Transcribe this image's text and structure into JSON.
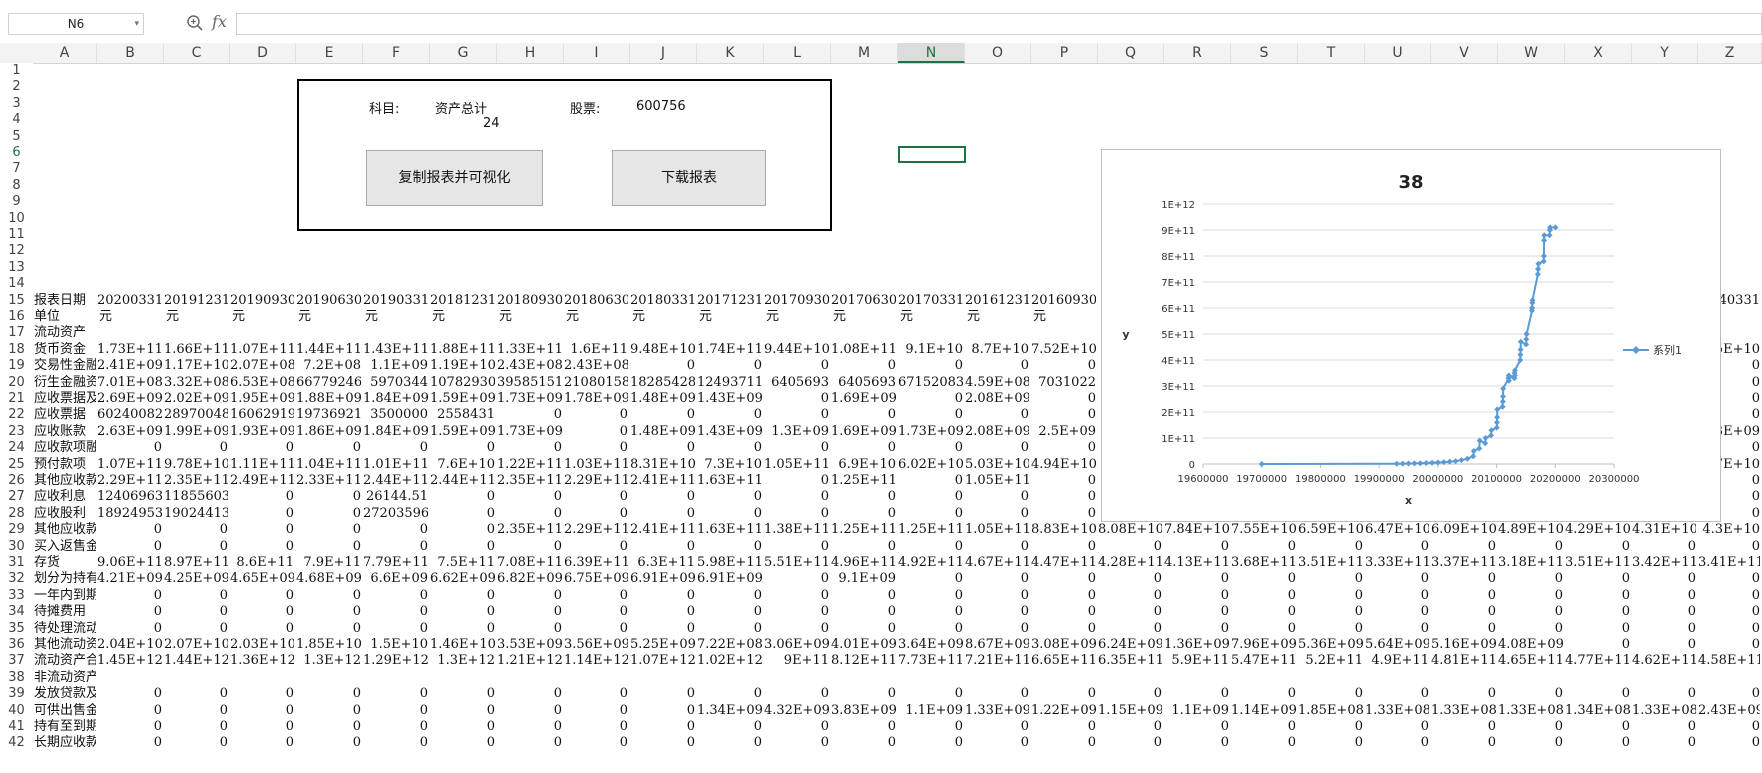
{
  "name_box": "N6",
  "formula_value": "",
  "columns": [
    "A",
    "B",
    "C",
    "D",
    "E",
    "F",
    "G",
    "H",
    "I",
    "J",
    "K",
    "L",
    "M",
    "N",
    "O",
    "P",
    "Q",
    "R",
    "S",
    "T",
    "U",
    "V",
    "W",
    "X",
    "Y",
    "Z"
  ],
  "selected_column": "N",
  "rows": [
    "1",
    "2",
    "3",
    "4",
    "5",
    "6",
    "7",
    "8",
    "9",
    "10",
    "11",
    "12",
    "13",
    "14",
    "15",
    "16",
    "17",
    "18",
    "19",
    "20",
    "21",
    "22",
    "23",
    "24",
    "25",
    "26",
    "27",
    "28",
    "29",
    "30",
    "31",
    "32",
    "33",
    "34",
    "35",
    "36",
    "37",
    "38",
    "39",
    "40",
    "41",
    "42"
  ],
  "selected_row": "6",
  "panel": {
    "subject_label": "科目:",
    "subject_value": "资产总计",
    "subject_index": "24",
    "stock_label": "股票:",
    "stock_code": "600756",
    "copy_button": "复制报表并可视化",
    "download_button": "下载报表"
  },
  "sheet": {
    "header_row": [
      "报表日期",
      "20200331",
      "20191231",
      "20190930",
      "20190630",
      "20190331",
      "20181231",
      "20180930",
      "20180630",
      "20180331",
      "20171231",
      "20170930",
      "20170630",
      "20170331",
      "20161231",
      "20160930",
      "",
      "",
      "",
      "",
      "",
      "",
      "",
      "",
      "",
      "140331"
    ],
    "unit_row": [
      "单位",
      "元",
      "元",
      "元",
      "元",
      "元",
      "元",
      "元",
      "元",
      "元",
      "元",
      "元",
      "元",
      "元",
      "元",
      "元"
    ],
    "data_rows": [
      [
        "流动资产"
      ],
      [
        "货币资金",
        "1.73E+11",
        "1.66E+11",
        "1.07E+11",
        "1.44E+11",
        "1.43E+11",
        "1.88E+11",
        "1.33E+11",
        "1.6E+11",
        "9.48E+10",
        "1.74E+11",
        "9.44E+10",
        "1.08E+11",
        "9.1E+10",
        "8.7E+10",
        "7.52E+10",
        "",
        "",
        "",
        "",
        "",
        "",
        "",
        "",
        "",
        "75E+10"
      ],
      [
        "交易性金融",
        "2.41E+09",
        "1.17E+10",
        "2.07E+08",
        "7.2E+08",
        "1.1E+09",
        "1.19E+10",
        "2.43E+08",
        "2.43E+08",
        "0",
        "0",
        "0",
        "0",
        "0",
        "0",
        "0",
        "",
        "",
        "",
        "",
        "",
        "",
        "",
        "",
        "",
        "0"
      ],
      [
        "衍生金融资",
        "7.01E+08",
        "3.32E+08",
        "6.53E+08",
        "66779246",
        "5970344",
        "10782930",
        "39585151",
        "21080158",
        "18285428",
        "12493711",
        "6405693",
        "6405693",
        "67152083",
        "4.59E+08",
        "7031022",
        "",
        "",
        "",
        "",
        "",
        "",
        "",
        "",
        "",
        "0"
      ],
      [
        "应收票据及",
        "2.69E+09",
        "2.02E+09",
        "1.95E+09",
        "1.88E+09",
        "1.84E+09",
        "1.59E+09",
        "1.73E+09",
        "1.78E+09",
        "1.48E+09",
        "1.43E+09",
        "0",
        "1.69E+09",
        "0",
        "2.08E+09",
        "0",
        "",
        "",
        "",
        "",
        "",
        "",
        "",
        "",
        "",
        "0"
      ],
      [
        "应收票据",
        "60240082",
        "28970048",
        "16062919",
        "19736921",
        "3500000",
        "2558431",
        "0",
        "0",
        "0",
        "0",
        "0",
        "0",
        "0",
        "0",
        "0",
        "",
        "",
        "",
        "",
        "",
        "",
        "",
        "",
        "",
        "0"
      ],
      [
        "应收账款",
        "2.63E+09",
        "1.99E+09",
        "1.93E+09",
        "1.86E+09",
        "1.84E+09",
        "1.59E+09",
        "1.73E+09",
        "0",
        "1.48E+09",
        "1.43E+09",
        "1.3E+09",
        "1.69E+09",
        "1.73E+09",
        "2.08E+09",
        "2.5E+09",
        "",
        "",
        "",
        "",
        "",
        "",
        "",
        "",
        "",
        "93E+09"
      ],
      [
        "应收款项融",
        "0",
        "0",
        "0",
        "0",
        "0",
        "0",
        "0",
        "0",
        "0",
        "0",
        "0",
        "0",
        "0",
        "0",
        "0",
        "",
        "",
        "",
        "",
        "",
        "",
        "",
        "",
        "",
        "0"
      ],
      [
        "预付款项",
        "1.07E+11",
        "9.78E+10",
        "1.11E+11",
        "1.04E+11",
        "1.01E+11",
        "7.6E+10",
        "1.22E+11",
        "1.03E+11",
        "8.31E+10",
        "7.3E+10",
        "1.05E+11",
        "6.9E+10",
        "6.02E+10",
        "5.03E+10",
        "4.94E+10",
        "",
        "",
        "",
        "",
        "",
        "",
        "",
        "",
        "",
        "37E+10"
      ],
      [
        "其他应收款",
        "2.29E+11",
        "2.35E+11",
        "2.49E+11",
        "2.33E+11",
        "2.44E+11",
        "2.44E+11",
        "2.35E+11",
        "2.29E+11",
        "2.41E+11",
        "1.63E+11",
        "0",
        "1.25E+11",
        "0",
        "1.05E+11",
        "0",
        "",
        "",
        "",
        "",
        "",
        "",
        "",
        "",
        "",
        "0"
      ],
      [
        "应收利息",
        "12406963",
        "11855603",
        "0",
        "0",
        "26144.51",
        "0",
        "0",
        "0",
        "0",
        "0",
        "0",
        "0",
        "0",
        "0",
        "0",
        "",
        "",
        "",
        "",
        "",
        "",
        "",
        "",
        "",
        "0"
      ],
      [
        "应收股利",
        "18924953",
        "19024413",
        "0",
        "0",
        "27203596",
        "0",
        "0",
        "0",
        "0",
        "0",
        "0",
        "0",
        "0",
        "0",
        "0",
        "",
        "",
        "",
        "",
        "",
        "",
        "",
        "",
        "",
        "0"
      ],
      [
        "其他应收款",
        "0",
        "0",
        "0",
        "0",
        "0",
        "0",
        "2.35E+11",
        "2.29E+11",
        "2.41E+11",
        "1.63E+11",
        "1.38E+11",
        "1.25E+11",
        "1.25E+11",
        "1.05E+11",
        "8.83E+10",
        "8.08E+10",
        "7.84E+10",
        "7.55E+10",
        "6.59E+10",
        "6.47E+10",
        "6.09E+10",
        "4.89E+10",
        "4.29E+10",
        "4.31E+10",
        "4.3E+10"
      ],
      [
        "买入返售金",
        "0",
        "0",
        "0",
        "0",
        "0",
        "0",
        "0",
        "0",
        "0",
        "0",
        "0",
        "0",
        "0",
        "0",
        "0",
        "0",
        "0",
        "0",
        "0",
        "0",
        "0",
        "0",
        "0",
        "0",
        "0"
      ],
      [
        "存货",
        "9.06E+11",
        "8.97E+11",
        "8.6E+11",
        "7.9E+11",
        "7.79E+11",
        "7.5E+11",
        "7.08E+11",
        "6.39E+11",
        "6.3E+11",
        "5.98E+11",
        "5.51E+11",
        "4.96E+11",
        "4.92E+11",
        "4.67E+11",
        "4.47E+11",
        "4.28E+11",
        "4.13E+11",
        "3.68E+11",
        "3.51E+11",
        "3.33E+11",
        "3.37E+11",
        "3.18E+11",
        "3.51E+11",
        "3.42E+11",
        "3.41E+11"
      ],
      [
        "划分为持有",
        "4.21E+09",
        "4.25E+09",
        "4.65E+09",
        "4.68E+09",
        "6.6E+09",
        "6.62E+09",
        "6.82E+09",
        "6.75E+09",
        "6.91E+09",
        "6.91E+09",
        "0",
        "9.1E+09",
        "0",
        "0",
        "0",
        "0",
        "0",
        "0",
        "0",
        "0",
        "0",
        "0",
        "0",
        "0",
        "0"
      ],
      [
        "一年内到期",
        "0",
        "0",
        "0",
        "0",
        "0",
        "0",
        "0",
        "0",
        "0",
        "0",
        "0",
        "0",
        "0",
        "0",
        "0",
        "0",
        "0",
        "0",
        "0",
        "0",
        "0",
        "0",
        "0",
        "0",
        "0"
      ],
      [
        "待摊费用",
        "0",
        "0",
        "0",
        "0",
        "0",
        "0",
        "0",
        "0",
        "0",
        "0",
        "0",
        "0",
        "0",
        "0",
        "0",
        "0",
        "0",
        "0",
        "0",
        "0",
        "0",
        "0",
        "0",
        "0",
        "0"
      ],
      [
        "待处理流动",
        "0",
        "0",
        "0",
        "0",
        "0",
        "0",
        "0",
        "0",
        "0",
        "0",
        "0",
        "0",
        "0",
        "0",
        "0",
        "0",
        "0",
        "0",
        "0",
        "0",
        "0",
        "0",
        "0",
        "0",
        "0"
      ],
      [
        "其他流动资",
        "2.04E+10",
        "2.07E+10",
        "2.03E+10",
        "1.85E+10",
        "1.5E+10",
        "1.46E+10",
        "3.53E+09",
        "3.56E+09",
        "5.25E+09",
        "7.22E+08",
        "3.06E+09",
        "4.01E+09",
        "3.64E+09",
        "8.67E+09",
        "3.08E+09",
        "6.24E+09",
        "1.36E+09",
        "7.96E+09",
        "5.36E+09",
        "5.64E+09",
        "5.16E+09",
        "4.08E+09",
        "0",
        "0",
        "0"
      ],
      [
        "流动资产合",
        "1.45E+12",
        "1.44E+12",
        "1.36E+12",
        "1.3E+12",
        "1.29E+12",
        "1.3E+12",
        "1.21E+12",
        "1.14E+12",
        "1.07E+12",
        "1.02E+12",
        "9E+11",
        "8.12E+11",
        "7.73E+11",
        "7.21E+11",
        "6.65E+11",
        "6.35E+11",
        "5.9E+11",
        "5.47E+11",
        "5.2E+11",
        "4.9E+11",
        "4.81E+11",
        "4.65E+11",
        "4.77E+11",
        "4.62E+11",
        "4.58E+11"
      ],
      [
        "非流动资产"
      ],
      [
        "发放贷款及",
        "0",
        "0",
        "0",
        "0",
        "0",
        "0",
        "0",
        "0",
        "0",
        "0",
        "0",
        "0",
        "0",
        "0",
        "0",
        "0",
        "0",
        "0",
        "0",
        "0",
        "0",
        "0",
        "0",
        "0",
        "0"
      ],
      [
        "可供出售金",
        "0",
        "0",
        "0",
        "0",
        "0",
        "0",
        "0",
        "0",
        "0",
        "1.34E+09",
        "4.32E+09",
        "3.83E+09",
        "1.1E+09",
        "1.33E+09",
        "1.22E+09",
        "1.15E+09",
        "1.1E+09",
        "1.14E+09",
        "1.85E+08",
        "1.33E+08",
        "1.33E+08",
        "1.33E+08",
        "1.34E+08",
        "1.33E+08",
        "2.43E+09"
      ],
      [
        "持有至到期",
        "0",
        "0",
        "0",
        "0",
        "0",
        "0",
        "0",
        "0",
        "0",
        "0",
        "0",
        "0",
        "0",
        "0",
        "0",
        "0",
        "0",
        "0",
        "0",
        "0",
        "0",
        "0",
        "0",
        "0",
        "0"
      ],
      [
        "长期应收款",
        "0",
        "0",
        "0",
        "0",
        "0",
        "0",
        "0",
        "0",
        "0",
        "0",
        "0",
        "0",
        "0",
        "0",
        "0",
        "0",
        "0",
        "0",
        "0",
        "0",
        "0",
        "0",
        "0",
        "0",
        "0"
      ]
    ]
  },
  "chart_data": {
    "type": "scatter",
    "title": "38",
    "xlabel": "x",
    "ylabel": "y",
    "legend": [
      "系列1"
    ],
    "legend_position": "right",
    "xlim": [
      19600000,
      20300000
    ],
    "ylim": [
      0,
      1000000000000
    ],
    "x_ticks": [
      "19600000",
      "19700000",
      "19800000",
      "19900000",
      "20000000",
      "20100000",
      "20200000",
      "20300000"
    ],
    "y_ticks": [
      "0",
      "1E+11",
      "2E+11",
      "3E+11",
      "4E+11",
      "5E+11",
      "6E+11",
      "7E+11",
      "8E+11",
      "9E+11",
      "1E+12"
    ],
    "grid": true,
    "color": "#5b9bd5",
    "series": [
      {
        "name": "系列1",
        "x": [
          19700101,
          19930101,
          19940101,
          19950101,
          19960101,
          19970101,
          19980101,
          19990101,
          20000101,
          20010101,
          20020101,
          20030101,
          20040101,
          20050101,
          20060101,
          20061231,
          20070630,
          20071231,
          20080630,
          20081231,
          20090630,
          20091231,
          20100331,
          20100630,
          20100930,
          20101231,
          20110331,
          20110630,
          20110930,
          20111231,
          20120331,
          20120630,
          20120930,
          20121231,
          20130331,
          20130630,
          20130930,
          20131231,
          20140331,
          20140630,
          20140930,
          20141231,
          20150331,
          20150630,
          20150930,
          20151231,
          20160331,
          20160630,
          20160930,
          20161231,
          20170331,
          20170630,
          20170930,
          20171231,
          20180331,
          20180630,
          20180930,
          20181231,
          20190331,
          20190630,
          20190930,
          20191231,
          20200331
        ],
        "y": [
          0,
          1000000000.0,
          1500000000.0,
          2000000000.0,
          2500000000.0,
          3000000000.0,
          4000000000.0,
          5000000000.0,
          6000000000.0,
          7000000000.0,
          9000000000.0,
          11000000000.0,
          15000000000.0,
          20000000000.0,
          30000000000.0,
          50000000000.0,
          60000000000.0,
          90000000000.0,
          80000000000.0,
          100000000000.0,
          110000000000.0,
          130000000000.0,
          140000000000.0,
          160000000000.0,
          180000000000.0,
          210000000000.0,
          220000000000.0,
          240000000000.0,
          260000000000.0,
          290000000000.0,
          330000000000.0,
          340000000000.0,
          320000000000.0,
          340000000000.0,
          330000000000.0,
          350000000000.0,
          340000000000.0,
          360000000000.0,
          400000000000.0,
          420000000000.0,
          440000000000.0,
          470000000000.0,
          460000000000.0,
          480000000000.0,
          500000000000.0,
          500000000000.0,
          590000000000.0,
          600000000000.0,
          620000000000.0,
          630000000000.0,
          730000000000.0,
          750000000000.0,
          750000000000.0,
          770000000000.0,
          780000000000.0,
          800000000000.0,
          860000000000.0,
          880000000000.0,
          880000000000.0,
          900000000000.0,
          900000000000.0,
          910000000000.0,
          910000000000.0
        ]
      }
    ]
  }
}
